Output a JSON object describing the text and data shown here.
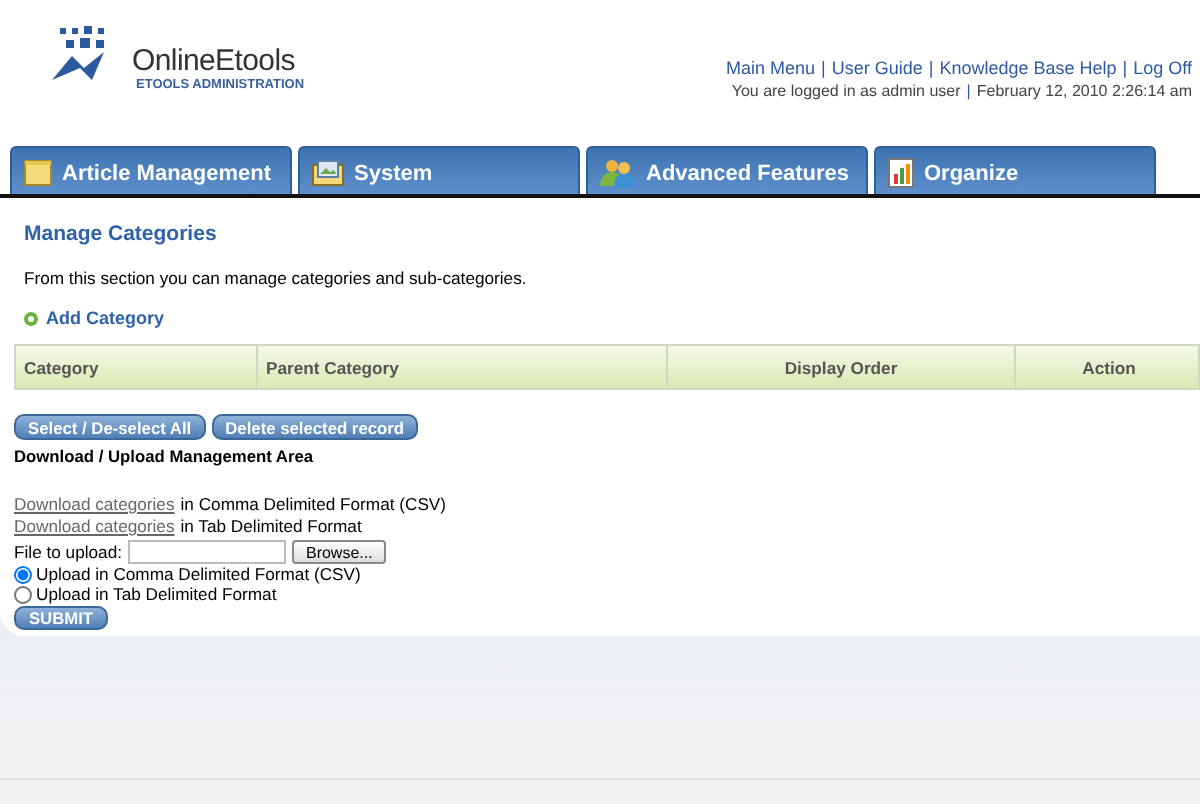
{
  "logo": {
    "name": "OnlineEtools",
    "subtitle": "ETOOLS ADMINISTRATION"
  },
  "header_links": [
    "Main Menu",
    "User Guide",
    "Knowledge Base Help",
    "Log Off"
  ],
  "header_link_separator": "|",
  "user_info": {
    "login": "You are logged in as admin user",
    "separator": "|",
    "date": "February 12, 2010 2:26:14 am"
  },
  "tabs": [
    {
      "label": "Article Management"
    },
    {
      "label": "System"
    },
    {
      "label": "Advanced Features"
    },
    {
      "label": "Organize"
    }
  ],
  "page": {
    "title": "Manage Categories",
    "description": "From this section you can manage categories and sub-categories.",
    "add_link": "Add Category"
  },
  "table": {
    "columns": [
      "Category",
      "Parent Category",
      "Display Order",
      "Action"
    ]
  },
  "table_buttons": [
    "Select / De-select All",
    "Delete selected record"
  ],
  "download_area": {
    "title": "Download / Upload Management Area",
    "downloads": [
      {
        "link": "Download categories",
        "text": "in Comma Delimited Format (CSV)"
      },
      {
        "link": "Download categories",
        "text": "in Tab Delimited Format"
      }
    ],
    "file_label": "File to upload:",
    "browse_button": "Browse...",
    "upload_formats": [
      {
        "label": "Upload in Comma Delimited Format (CSV)",
        "selected": true
      },
      {
        "label": "Upload in Tab Delimited Format",
        "selected": false
      }
    ],
    "submit_button": "SUBMIT"
  }
}
